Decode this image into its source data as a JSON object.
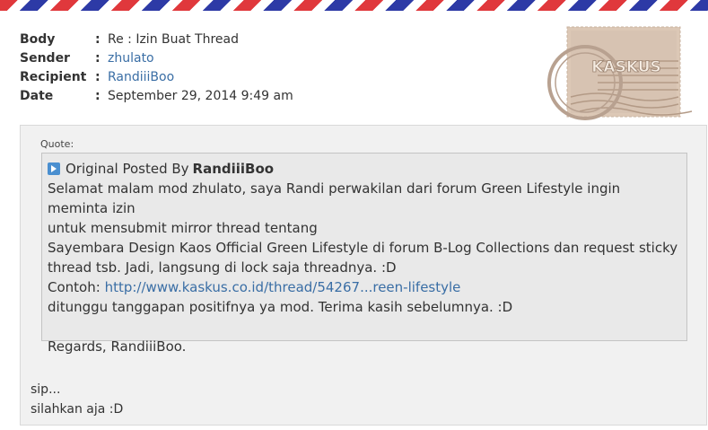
{
  "header": {
    "body_label": "Body",
    "body_value": "Re : Izin Buat Thread",
    "sender_label": "Sender",
    "sender_value": "zhulato",
    "recipient_label": "Recipient",
    "recipient_value": "RandiiiBoo",
    "date_label": "Date",
    "date_value": "September 29, 2014 9:49 am",
    "separator": ":"
  },
  "stamp": {
    "brand": "KASKUS",
    "icon": "postage-stamp-icon"
  },
  "quote": {
    "caption": "Quote:",
    "prefix": "Original Posted By",
    "author": "RandiiiBoo",
    "line1": "Selamat malam mod zhulato, saya Randi perwakilan dari forum Green Lifestyle ingin meminta izin",
    "line2": "untuk mensubmit mirror thread tentang",
    "line3": "Sayembara Design Kaos Official Green Lifestyle di forum B-Log Collections dan request sticky",
    "line4": "thread tsb. Jadi, langsung di lock saja threadnya. :D",
    "contoh_label": "Contoh:",
    "contoh_link": "http://www.kaskus.co.id/thread/54267...reen-lifestyle",
    "line6": "ditunggu tanggapan positifnya ya mod. Terima kasih sebelumnya. :D",
    "regards": "Regards, RandiiiBoo."
  },
  "reply": {
    "line1": "sip...",
    "line2": "silahkan aja :D"
  },
  "colors": {
    "link": "#3a6ea5",
    "stripe_red": "#e0383c",
    "stripe_blue": "#2d3aa6",
    "stamp": "#d7c3b2"
  }
}
